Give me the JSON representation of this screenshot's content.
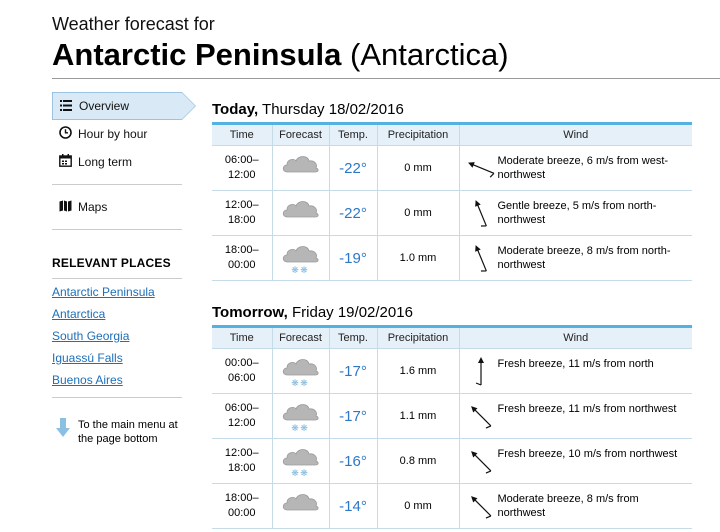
{
  "header": {
    "prefix": "Weather forecast for",
    "location": "Antarctic Peninsula",
    "region": "(Antarctica)"
  },
  "sidebar": {
    "nav": [
      {
        "label": "Overview",
        "icon": "list-icon",
        "active": true
      },
      {
        "label": "Hour by hour",
        "icon": "clock-icon"
      },
      {
        "label": "Long term",
        "icon": "calendar-icon"
      },
      {
        "label": "Maps",
        "icon": "map-icon"
      }
    ],
    "relevant_heading": "RELEVANT PLACES",
    "places": [
      "Antarctic Peninsula",
      "Antarctica",
      "South Georgia",
      "Iguassú Falls",
      "Buenos Aires"
    ],
    "main_menu_text": "To the main menu at the page bottom"
  },
  "columns": {
    "time": "Time",
    "forecast": "Forecast",
    "temp": "Temp.",
    "precip": "Precipitation",
    "wind": "Wind"
  },
  "days": [
    {
      "day_bold": "Today,",
      "day_rest": "Thursday 18/02/2016",
      "rows": [
        {
          "time_from": "06:00–",
          "time_to": "12:00",
          "icon": "cloud-icon",
          "temp": "-22°",
          "precip": "0 mm",
          "wind": "Moderate breeze, 6 m/s from west-northwest",
          "wind_from_deg": 292.5
        },
        {
          "time_from": "12:00–",
          "time_to": "18:00",
          "icon": "cloud-icon",
          "temp": "-22°",
          "precip": "0 mm",
          "wind": "Gentle breeze, 5 m/s from north-northwest",
          "wind_from_deg": 337.5
        },
        {
          "time_from": "18:00–",
          "time_to": "00:00",
          "icon": "cloud-snow-icon",
          "temp": "-19°",
          "precip": "1.0 mm",
          "wind": "Moderate breeze, 8 m/s from north-northwest",
          "wind_from_deg": 337.5
        }
      ]
    },
    {
      "day_bold": "Tomorrow,",
      "day_rest": "Friday 19/02/2016",
      "rows": [
        {
          "time_from": "00:00–",
          "time_to": "06:00",
          "icon": "cloud-snow-icon",
          "temp": "-17°",
          "precip": "1.6 mm",
          "wind": "Fresh breeze, 11 m/s from north",
          "wind_from_deg": 0
        },
        {
          "time_from": "06:00–",
          "time_to": "12:00",
          "icon": "cloud-snow-icon",
          "temp": "-17°",
          "precip": "1.1 mm",
          "wind": "Fresh breeze, 11 m/s from northwest",
          "wind_from_deg": 315
        },
        {
          "time_from": "12:00–",
          "time_to": "18:00",
          "icon": "cloud-snow-icon",
          "temp": "-16°",
          "precip": "0.8 mm",
          "wind": "Fresh breeze, 10 m/s from northwest",
          "wind_from_deg": 315
        },
        {
          "time_from": "18:00–",
          "time_to": "00:00",
          "icon": "cloud-icon",
          "temp": "-14°",
          "precip": "0 mm",
          "wind": "Moderate breeze, 8 m/s from northwest",
          "wind_from_deg": 315
        }
      ]
    }
  ],
  "colors": {
    "accent": "#54b2e3",
    "link": "#1d6fb8",
    "temp": "#2d78c6",
    "header_bg": "#e6f0f8"
  }
}
